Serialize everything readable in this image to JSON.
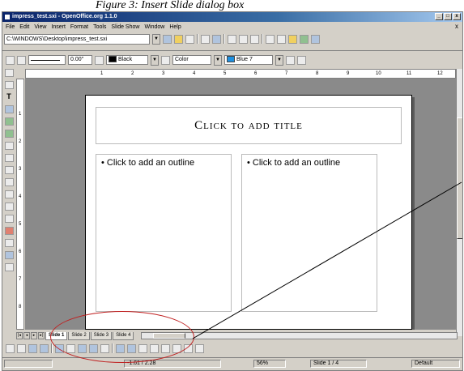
{
  "caption": "Figure 3: Insert Slide dialog box",
  "window": {
    "title": "impress_test.sxi - OpenOffice.org 1.1.0",
    "buttons": [
      "_",
      "□",
      "x"
    ]
  },
  "menu": {
    "items": [
      "File",
      "Edit",
      "View",
      "Insert",
      "Format",
      "Tools",
      "Slide Show",
      "Window",
      "Help"
    ],
    "close": "x"
  },
  "url": {
    "value": "C:\\WINDOWS\\Desktop\\impress_test.sxi"
  },
  "line_toolbar": {
    "line_width": "0.00\"",
    "line_color": "Black",
    "area_style": "Color",
    "area_color": "Blue 7",
    "colors": {
      "black": "#000000",
      "blue7": "#1e90e0"
    }
  },
  "ruler": {
    "h_ticks": [
      "1",
      "2",
      "3",
      "4",
      "5",
      "6",
      "7",
      "8",
      "9",
      "10",
      "11",
      "12"
    ],
    "v_ticks": [
      "1",
      "2",
      "3",
      "4",
      "5",
      "6",
      "7",
      "8"
    ]
  },
  "slide": {
    "title": "Click to add title",
    "outline_left": "• Click to add an outline",
    "outline_right": "• Click to add an outline"
  },
  "tabs": [
    "Slide 1",
    "Slide 2",
    "Slide 3",
    "Slide 4"
  ],
  "status": {
    "position": "-1.61 / 2.28",
    "zoom": "56%",
    "slide": "Slide 1 / 4",
    "layout": "Default"
  },
  "annotation_color": "#c02020"
}
